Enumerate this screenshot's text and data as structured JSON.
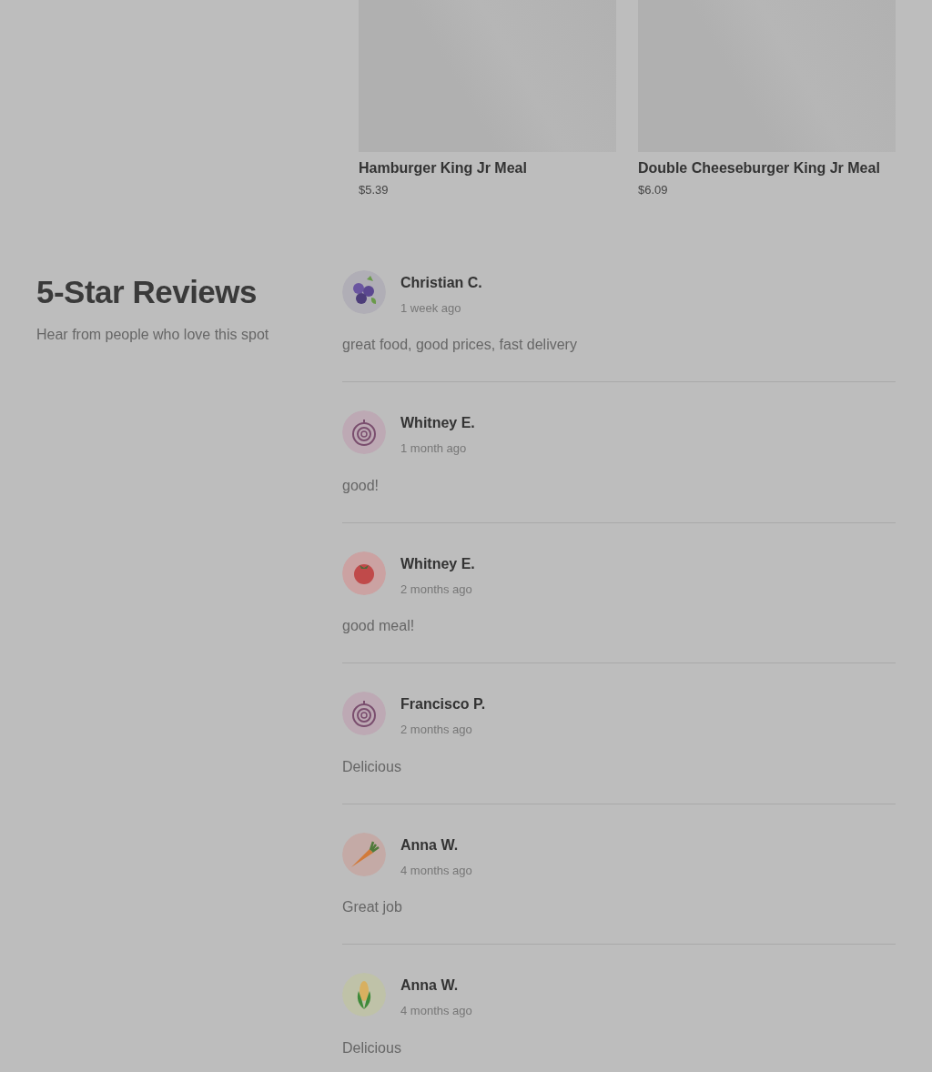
{
  "products": [
    {
      "name": "Hamburger King Jr Meal",
      "price": "$5.39"
    },
    {
      "name": "Double Cheeseburger King Jr Meal",
      "price": "$6.09"
    }
  ],
  "reviews_section": {
    "title": "5-Star Reviews",
    "subtitle": "Hear from people who love this spot"
  },
  "reviews": [
    {
      "avatar": {
        "kind": "blueberry"
      },
      "author": "Christian C.",
      "time": "1 week ago",
      "text": "great food, good prices, fast delivery"
    },
    {
      "avatar": {
        "kind": "onion"
      },
      "author": "Whitney E.",
      "time": "1 month ago",
      "text": "good!"
    },
    {
      "avatar": {
        "kind": "tomato"
      },
      "author": "Whitney E.",
      "time": "2 months ago",
      "text": "good meal!"
    },
    {
      "avatar": {
        "kind": "onion"
      },
      "author": "Francisco P.",
      "time": "2 months ago",
      "text": "Delicious"
    },
    {
      "avatar": {
        "kind": "carrot"
      },
      "author": "Anna W.",
      "time": "4 months ago",
      "text": "Great job"
    },
    {
      "avatar": {
        "kind": "corn"
      },
      "author": "Anna W.",
      "time": "4 months ago",
      "text": "Delicious"
    }
  ]
}
